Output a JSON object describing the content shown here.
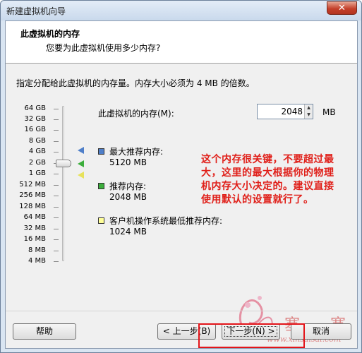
{
  "window": {
    "title": "新建虚拟机向导",
    "close_label": "✕"
  },
  "header": {
    "title": "此虚拟机的内存",
    "subtitle": "您要为此虚拟机使用多少内存?"
  },
  "instruction": "指定分配给此虚拟机的内存量。内存大小必须为 4 MB 的倍数。",
  "scale_labels": [
    "64 GB",
    "32 GB",
    "16 GB",
    "8 GB",
    "4 GB",
    "2 GB",
    "1 GB",
    "512 MB",
    "256 MB",
    "128 MB",
    "64 MB",
    "32 MB",
    "16 MB",
    "8 MB",
    "4 MB"
  ],
  "slider": {
    "selected": "2048 MB"
  },
  "memory": {
    "label": "此虚拟机的内存(M):",
    "value": "2048",
    "unit": "MB"
  },
  "legend": {
    "max": {
      "title": "最大推荐内存:",
      "value": "5120 MB",
      "color": "#4f7fc9"
    },
    "recommended": {
      "title": "推荐内存:",
      "value": "2048 MB",
      "color": "#3cae3c"
    },
    "min": {
      "title": "客户机操作系统最低推荐内存:",
      "value": "1024 MB",
      "color": "#ffff99"
    }
  },
  "note": "这个内存很关键，不要超过最大，这里的最大根据你的物理机内存大小决定的。建议直接使用默认的设置就行了。",
  "watermark": {
    "text_cn": "塞 塞",
    "text_url": "www.xinsaisai.com"
  },
  "buttons": {
    "help": "帮助",
    "back": "< 上一步(B)",
    "next": "下一步(N) >",
    "cancel": "取消"
  }
}
